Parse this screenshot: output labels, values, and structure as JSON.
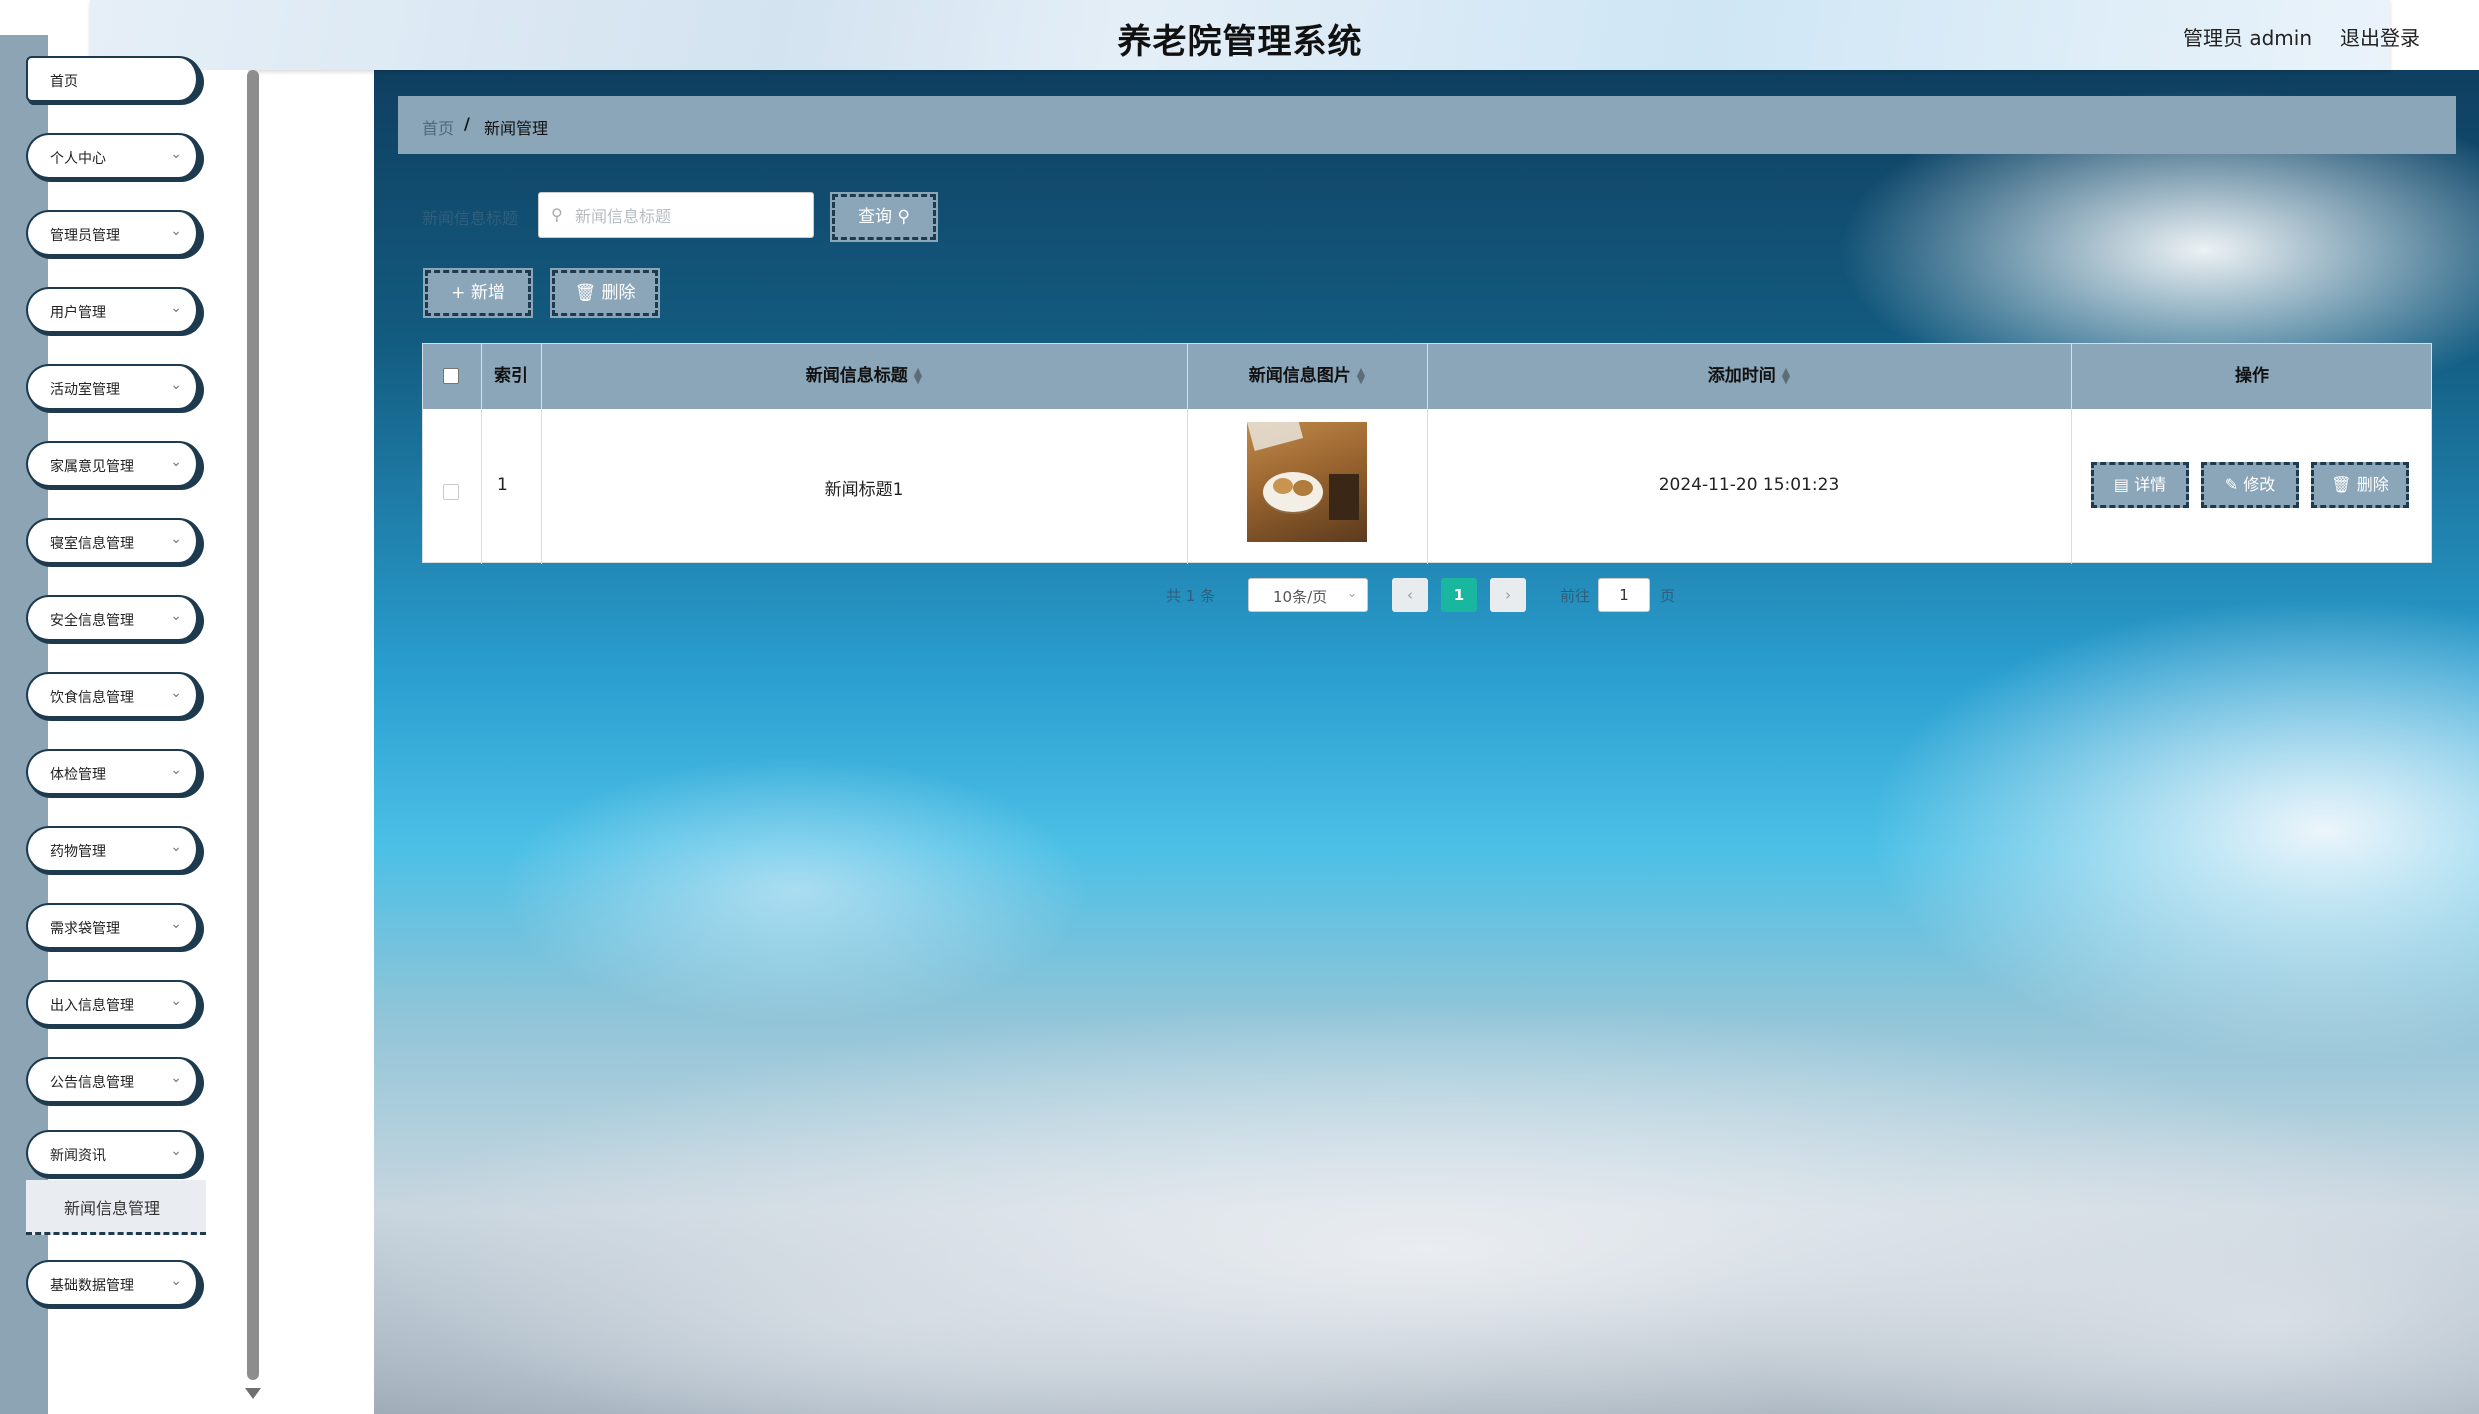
{
  "header": {
    "title": "养老院管理系统",
    "user": "管理员 admin",
    "logout": "退出登录"
  },
  "sidebar": {
    "items": [
      {
        "label": "首页",
        "has_chevron": false
      },
      {
        "label": "个人中心",
        "has_chevron": true
      },
      {
        "label": "管理员管理",
        "has_chevron": true
      },
      {
        "label": "用户管理",
        "has_chevron": true
      },
      {
        "label": "活动室管理",
        "has_chevron": true
      },
      {
        "label": "家属意见管理",
        "has_chevron": true
      },
      {
        "label": "寝室信息管理",
        "has_chevron": true
      },
      {
        "label": "安全信息管理",
        "has_chevron": true
      },
      {
        "label": "饮食信息管理",
        "has_chevron": true
      },
      {
        "label": "体检管理",
        "has_chevron": true
      },
      {
        "label": "药物管理",
        "has_chevron": true
      },
      {
        "label": "需求袋管理",
        "has_chevron": true
      },
      {
        "label": "出入信息管理",
        "has_chevron": true
      },
      {
        "label": "公告信息管理",
        "has_chevron": true
      },
      {
        "label": "新闻资讯",
        "has_chevron": true
      },
      {
        "label": "基础数据管理",
        "has_chevron": true
      }
    ],
    "active_submenu": "新闻信息管理"
  },
  "breadcrumb": {
    "home": "首页",
    "separator": "/",
    "current": "新闻管理"
  },
  "search": {
    "label": "新闻信息标题",
    "placeholder": "新闻信息标题",
    "value": "",
    "query_button": "查询"
  },
  "actions": {
    "add": "新增",
    "delete": "删除"
  },
  "table": {
    "columns": [
      "索引",
      "新闻信息标题",
      "新闻信息图片",
      "添加时间",
      "操作"
    ],
    "rows": [
      {
        "index": "1",
        "title": "新闻标题1",
        "time": "2024-11-20 15:01:23",
        "ops": [
          "详情",
          "修改",
          "删除"
        ]
      }
    ]
  },
  "pagination": {
    "total": "共 1 条",
    "page_size": "10条/页",
    "current_page": "1",
    "goto_label": "前往",
    "goto_value": "1",
    "goto_suffix": "页"
  },
  "colors": {
    "accent": "#8ba6b9",
    "border_dark": "#1d3a4e",
    "page_active": "#19b79f"
  }
}
